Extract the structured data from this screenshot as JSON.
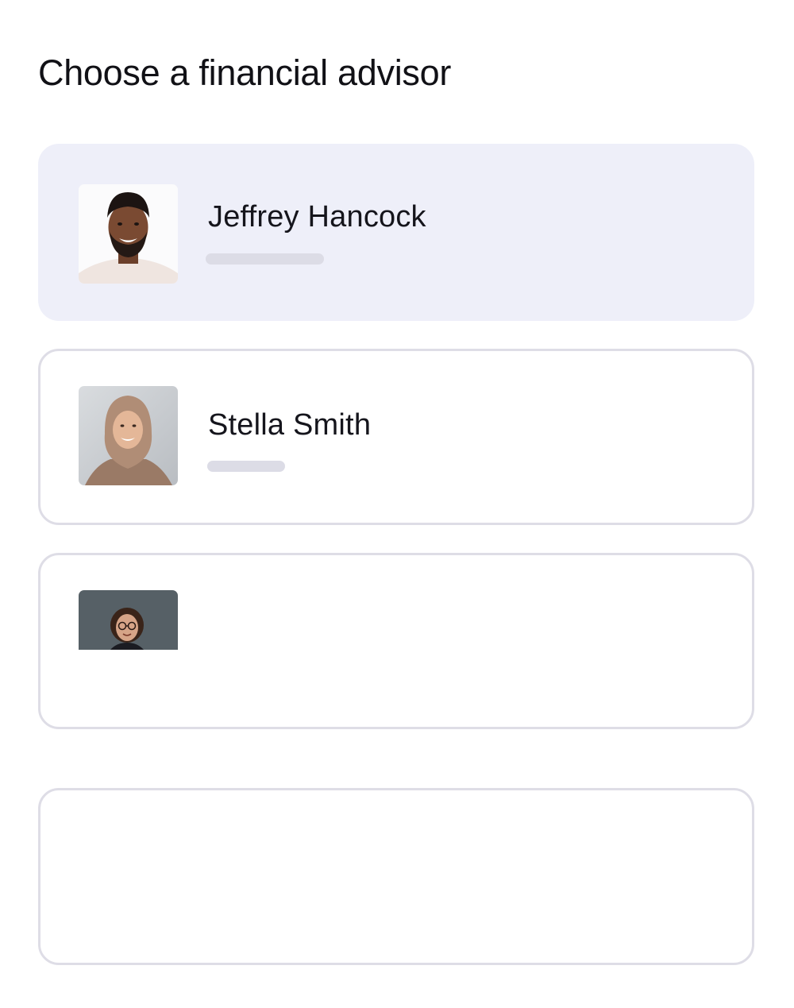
{
  "header": {
    "title": "Choose a financial advisor"
  },
  "advisors": [
    {
      "name": "Jeffrey Hancock",
      "selected": true,
      "avatar_icon": "advisor-photo-man"
    },
    {
      "name": "Stella Smith",
      "selected": false,
      "avatar_icon": "advisor-photo-woman-hijab"
    },
    {
      "name": "",
      "selected": false,
      "avatar_icon": "advisor-photo-woman-glasses"
    },
    {
      "name": "",
      "selected": false,
      "avatar_icon": ""
    }
  ],
  "colors": {
    "selected_card_bg": "#eeeff9",
    "card_border": "#dedde6",
    "skeleton": "#dcdce6",
    "text": "#15151c"
  }
}
